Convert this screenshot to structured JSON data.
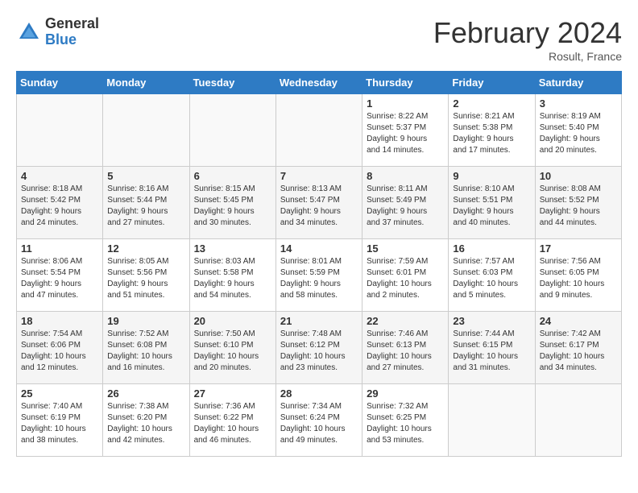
{
  "header": {
    "logo_general": "General",
    "logo_blue": "Blue",
    "title": "February 2024",
    "location": "Rosult, France"
  },
  "days_of_week": [
    "Sunday",
    "Monday",
    "Tuesday",
    "Wednesday",
    "Thursday",
    "Friday",
    "Saturday"
  ],
  "weeks": [
    [
      {
        "num": "",
        "info": ""
      },
      {
        "num": "",
        "info": ""
      },
      {
        "num": "",
        "info": ""
      },
      {
        "num": "",
        "info": ""
      },
      {
        "num": "1",
        "info": "Sunrise: 8:22 AM\nSunset: 5:37 PM\nDaylight: 9 hours\nand 14 minutes."
      },
      {
        "num": "2",
        "info": "Sunrise: 8:21 AM\nSunset: 5:38 PM\nDaylight: 9 hours\nand 17 minutes."
      },
      {
        "num": "3",
        "info": "Sunrise: 8:19 AM\nSunset: 5:40 PM\nDaylight: 9 hours\nand 20 minutes."
      }
    ],
    [
      {
        "num": "4",
        "info": "Sunrise: 8:18 AM\nSunset: 5:42 PM\nDaylight: 9 hours\nand 24 minutes."
      },
      {
        "num": "5",
        "info": "Sunrise: 8:16 AM\nSunset: 5:44 PM\nDaylight: 9 hours\nand 27 minutes."
      },
      {
        "num": "6",
        "info": "Sunrise: 8:15 AM\nSunset: 5:45 PM\nDaylight: 9 hours\nand 30 minutes."
      },
      {
        "num": "7",
        "info": "Sunrise: 8:13 AM\nSunset: 5:47 PM\nDaylight: 9 hours\nand 34 minutes."
      },
      {
        "num": "8",
        "info": "Sunrise: 8:11 AM\nSunset: 5:49 PM\nDaylight: 9 hours\nand 37 minutes."
      },
      {
        "num": "9",
        "info": "Sunrise: 8:10 AM\nSunset: 5:51 PM\nDaylight: 9 hours\nand 40 minutes."
      },
      {
        "num": "10",
        "info": "Sunrise: 8:08 AM\nSunset: 5:52 PM\nDaylight: 9 hours\nand 44 minutes."
      }
    ],
    [
      {
        "num": "11",
        "info": "Sunrise: 8:06 AM\nSunset: 5:54 PM\nDaylight: 9 hours\nand 47 minutes."
      },
      {
        "num": "12",
        "info": "Sunrise: 8:05 AM\nSunset: 5:56 PM\nDaylight: 9 hours\nand 51 minutes."
      },
      {
        "num": "13",
        "info": "Sunrise: 8:03 AM\nSunset: 5:58 PM\nDaylight: 9 hours\nand 54 minutes."
      },
      {
        "num": "14",
        "info": "Sunrise: 8:01 AM\nSunset: 5:59 PM\nDaylight: 9 hours\nand 58 minutes."
      },
      {
        "num": "15",
        "info": "Sunrise: 7:59 AM\nSunset: 6:01 PM\nDaylight: 10 hours\nand 2 minutes."
      },
      {
        "num": "16",
        "info": "Sunrise: 7:57 AM\nSunset: 6:03 PM\nDaylight: 10 hours\nand 5 minutes."
      },
      {
        "num": "17",
        "info": "Sunrise: 7:56 AM\nSunset: 6:05 PM\nDaylight: 10 hours\nand 9 minutes."
      }
    ],
    [
      {
        "num": "18",
        "info": "Sunrise: 7:54 AM\nSunset: 6:06 PM\nDaylight: 10 hours\nand 12 minutes."
      },
      {
        "num": "19",
        "info": "Sunrise: 7:52 AM\nSunset: 6:08 PM\nDaylight: 10 hours\nand 16 minutes."
      },
      {
        "num": "20",
        "info": "Sunrise: 7:50 AM\nSunset: 6:10 PM\nDaylight: 10 hours\nand 20 minutes."
      },
      {
        "num": "21",
        "info": "Sunrise: 7:48 AM\nSunset: 6:12 PM\nDaylight: 10 hours\nand 23 minutes."
      },
      {
        "num": "22",
        "info": "Sunrise: 7:46 AM\nSunset: 6:13 PM\nDaylight: 10 hours\nand 27 minutes."
      },
      {
        "num": "23",
        "info": "Sunrise: 7:44 AM\nSunset: 6:15 PM\nDaylight: 10 hours\nand 31 minutes."
      },
      {
        "num": "24",
        "info": "Sunrise: 7:42 AM\nSunset: 6:17 PM\nDaylight: 10 hours\nand 34 minutes."
      }
    ],
    [
      {
        "num": "25",
        "info": "Sunrise: 7:40 AM\nSunset: 6:19 PM\nDaylight: 10 hours\nand 38 minutes."
      },
      {
        "num": "26",
        "info": "Sunrise: 7:38 AM\nSunset: 6:20 PM\nDaylight: 10 hours\nand 42 minutes."
      },
      {
        "num": "27",
        "info": "Sunrise: 7:36 AM\nSunset: 6:22 PM\nDaylight: 10 hours\nand 46 minutes."
      },
      {
        "num": "28",
        "info": "Sunrise: 7:34 AM\nSunset: 6:24 PM\nDaylight: 10 hours\nand 49 minutes."
      },
      {
        "num": "29",
        "info": "Sunrise: 7:32 AM\nSunset: 6:25 PM\nDaylight: 10 hours\nand 53 minutes."
      },
      {
        "num": "",
        "info": ""
      },
      {
        "num": "",
        "info": ""
      }
    ]
  ]
}
